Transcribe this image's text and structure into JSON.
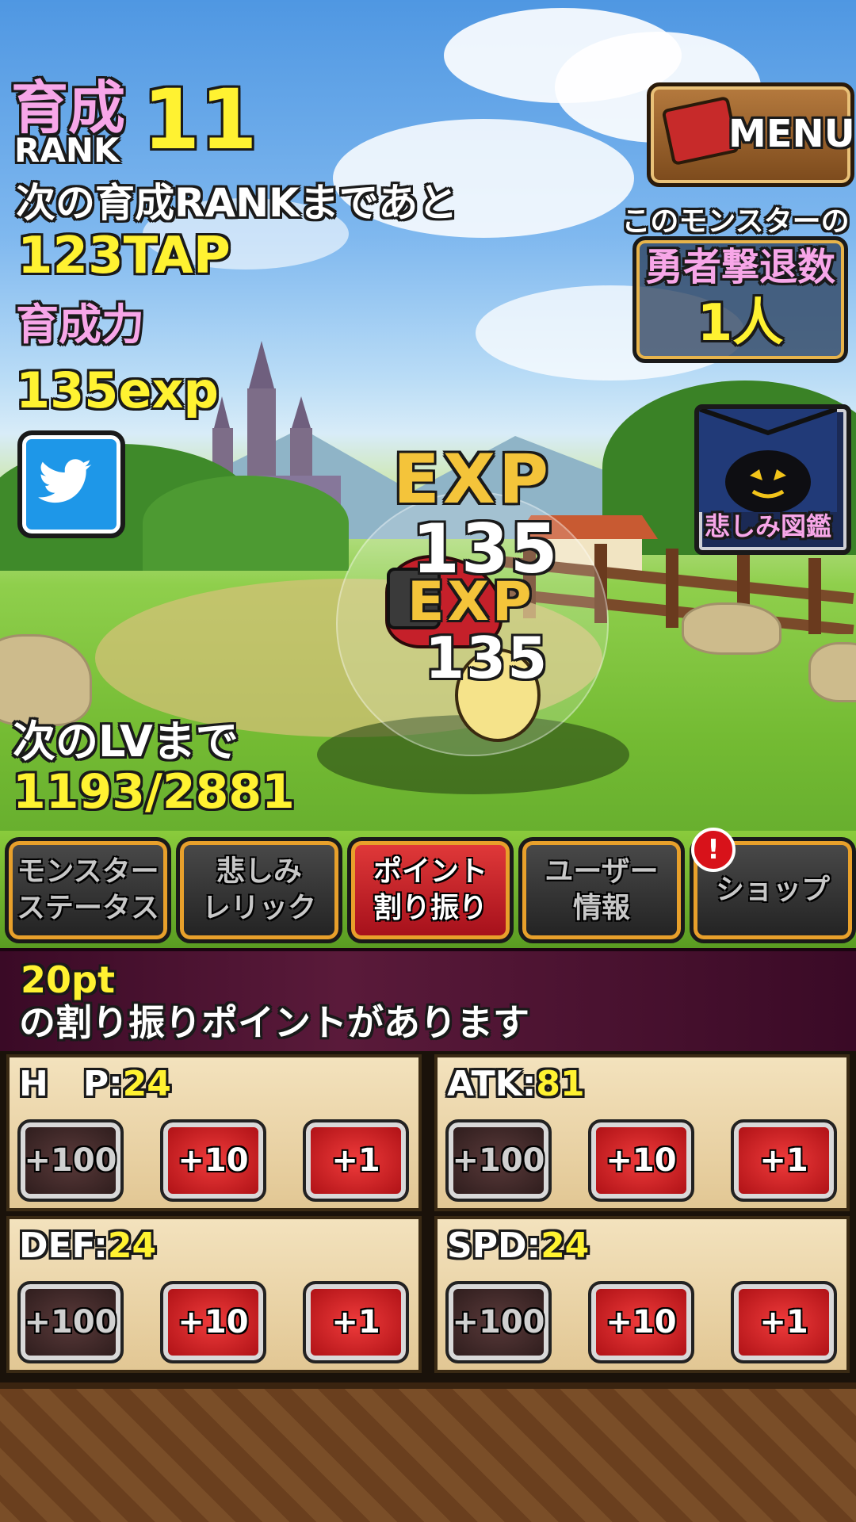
{
  "hud": {
    "rank_title": "育成",
    "rank_sub": "RANK",
    "rank_value": "11",
    "next_rank_label": "次の育成RANKまであと",
    "next_rank_value": "123TAP",
    "power_label": "育成力",
    "power_value": "135exp",
    "next_level_label": "次のLVまで",
    "next_level_value": "1193/2881"
  },
  "menu": {
    "label": "MENU"
  },
  "kill_counter": {
    "header": "このモンスターの",
    "title": "勇者撃退数",
    "value": "1人"
  },
  "sorrow_book": {
    "label": "悲しみ図鑑"
  },
  "exp_popups": [
    {
      "label": "EXP",
      "value": "135"
    },
    {
      "label": "EXP",
      "value": "135"
    }
  ],
  "tabs": [
    {
      "label": "モンスター\nステータス",
      "active": false
    },
    {
      "label": "悲しみ\nレリック",
      "active": false
    },
    {
      "label": "ポイント\n割り振り",
      "active": true
    },
    {
      "label": "ユーザー\n情報",
      "active": false
    },
    {
      "label": "ショップ",
      "active": false,
      "alert": "!"
    }
  ],
  "notice": {
    "points": "20pt",
    "message": "の割り振りポイントがあります"
  },
  "stats": [
    {
      "label": "H　P:",
      "value": "24",
      "buttons": [
        "+100",
        "+10",
        "+1"
      ]
    },
    {
      "label": "ATK:",
      "value": "81",
      "buttons": [
        "+100",
        "+10",
        "+1"
      ]
    },
    {
      "label": "DEF:",
      "value": "24",
      "buttons": [
        "+100",
        "+10",
        "+1"
      ]
    },
    {
      "label": "SPD:",
      "value": "24",
      "buttons": [
        "+100",
        "+10",
        "+1"
      ]
    }
  ],
  "colors": {
    "accent_yellow": "#fff231",
    "accent_pink": "#f7a6e8",
    "active_tab": "#d8242c"
  },
  "icons": [
    "twitter-icon",
    "toolbox-icon",
    "alert-icon",
    "pumpkin-ghost-icon"
  ]
}
